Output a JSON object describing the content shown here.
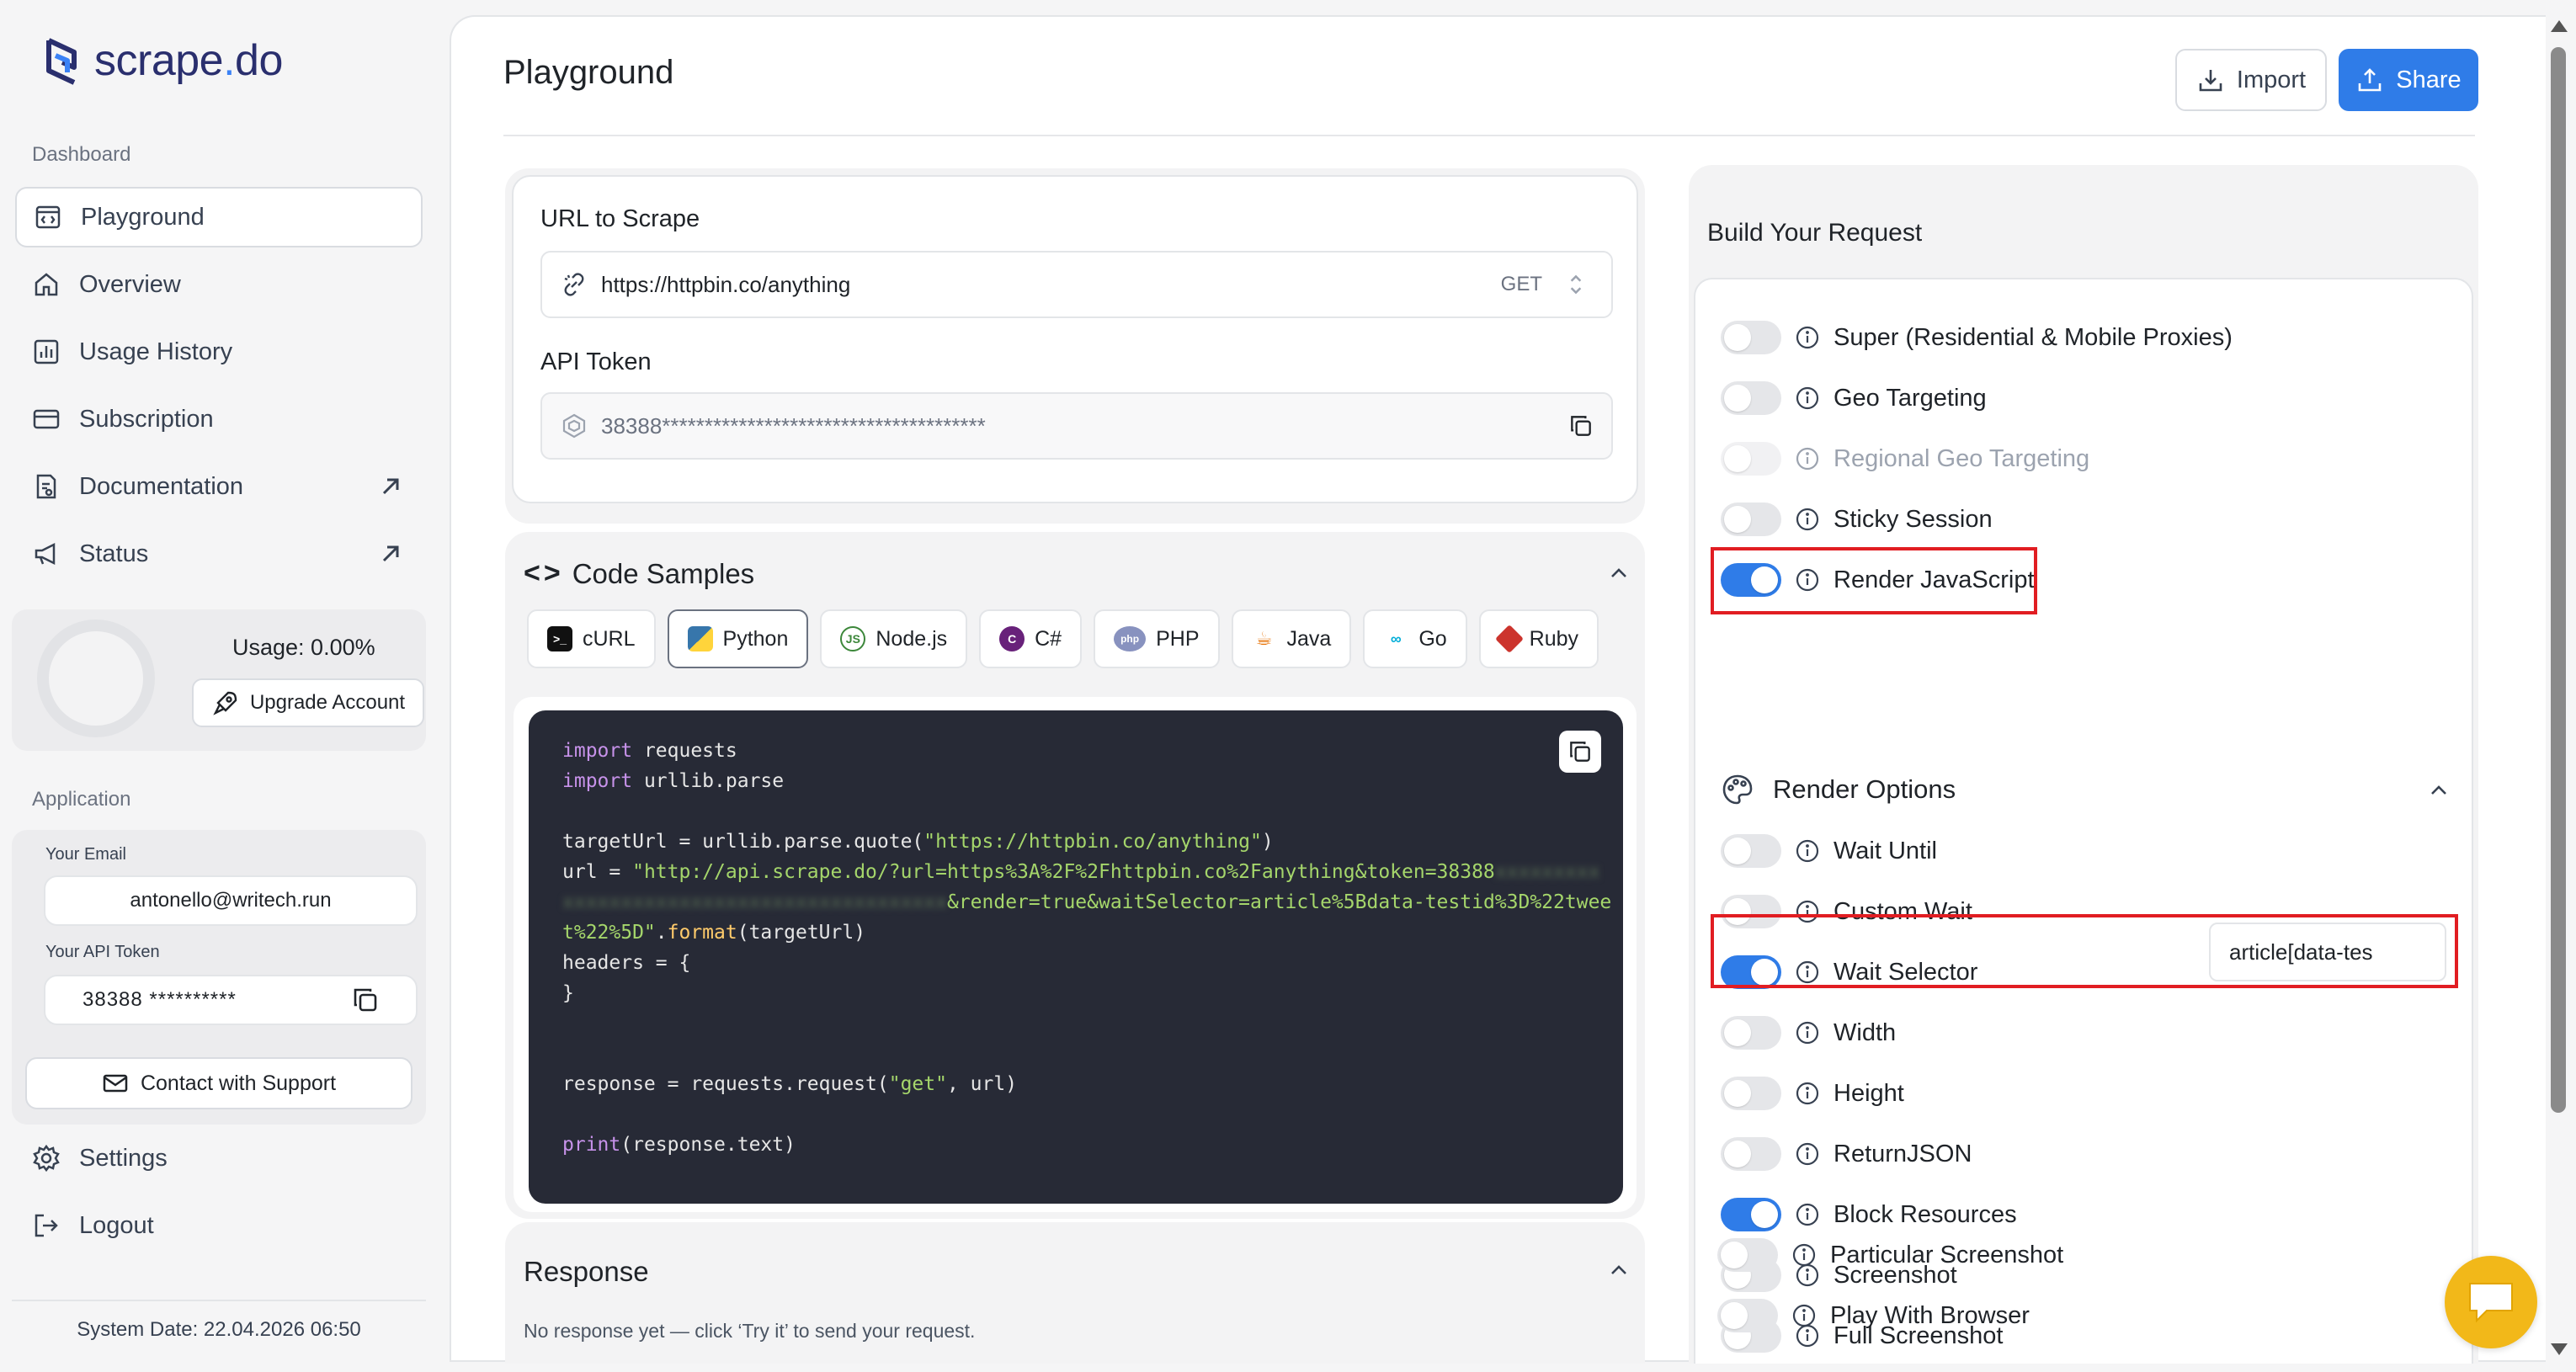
{
  "brand": {
    "name_main": "scrape",
    "name_dot": ".",
    "name_end": "do",
    "accent": "#3b82f6"
  },
  "sidebar": {
    "section_dashboard": "Dashboard",
    "items": [
      {
        "label": "Playground",
        "icon": "playground-icon",
        "active": true
      },
      {
        "label": "Overview",
        "icon": "home-icon"
      },
      {
        "label": "Usage History",
        "icon": "chart-icon"
      },
      {
        "label": "Subscription",
        "icon": "card-icon"
      },
      {
        "label": "Documentation",
        "icon": "document-icon",
        "external": true
      },
      {
        "label": "Status",
        "icon": "megaphone-icon",
        "external": true
      }
    ],
    "usage_label": "Usage: 0.00%",
    "upgrade_label": "Upgrade Account",
    "section_application": "Application",
    "email_label": "Your Email",
    "email_value": "antonello@writech.run",
    "token_label": "Your API Token",
    "token_value": "38388 **********",
    "support_label": "Contact with Support",
    "settings_label": "Settings",
    "logout_label": "Logout",
    "system_date": "System Date: 22.04.2026 06:50"
  },
  "header": {
    "title": "Playground",
    "import_label": "Import",
    "share_label": "Share",
    "share_color": "#2f7ce8"
  },
  "request": {
    "url_label": "URL to Scrape",
    "url_value": "https://httpbin.co/anything",
    "method": "GET",
    "token_label": "API Token",
    "token_value": "38388**************************************"
  },
  "code_samples": {
    "title": "Code Samples",
    "tabs": [
      {
        "label": "cURL",
        "icon": "terminal-icon"
      },
      {
        "label": "Python",
        "icon": "python-icon",
        "active": true
      },
      {
        "label": "Node.js",
        "icon": "nodejs-icon"
      },
      {
        "label": "C#",
        "icon": "csharp-icon"
      },
      {
        "label": "PHP",
        "icon": "php-icon"
      },
      {
        "label": "Java",
        "icon": "java-icon"
      },
      {
        "label": "Go",
        "icon": "go-icon"
      },
      {
        "label": "Ruby",
        "icon": "ruby-icon"
      }
    ],
    "code": {
      "l1_kw": "import",
      "l1_rest": " requests",
      "l2_kw": "import",
      "l2_rest": " urllib.parse",
      "l4_a": "targetUrl = urllib.parse.quote(",
      "l4_str": "\"https://httpbin.co/anything\"",
      "l4_b": ")",
      "l5_a": "url = ",
      "l5_str": "\"http://api.scrape.do/?url=https%3A%2F%2Fhttpbin.co%2Fanything&token=38388",
      "l5_blur": "xxxxxxxxx",
      "l6_blur": "xxxxxxxxxxxxxxxxxxxxxxxxxxxxxxxxx",
      "l6_str": "&render=true&waitSelector=article%5Bdata-testid%3D%22twee",
      "l7_str": "t%22%5D\"",
      "l7_dot": ".",
      "l7_fn": "format",
      "l7_rest": "(targetUrl)",
      "l8": "headers = {",
      "l9": "}",
      "l12_a": "response = requests.request(",
      "l12_str": "\"get\"",
      "l12_b": ", url)",
      "l14_fn": "print",
      "l14_rest": "(response.text)"
    }
  },
  "response": {
    "title": "Response",
    "empty_text": "No response yet — click ‘Try it’ to send your request."
  },
  "build": {
    "title": "Build Your Request",
    "options": [
      {
        "label": "Super (Residential & Mobile Proxies)",
        "on": false
      },
      {
        "label": "Geo Targeting",
        "on": false
      },
      {
        "label": "Regional Geo Targeting",
        "on": false,
        "disabled": true
      },
      {
        "label": "Sticky Session",
        "on": false
      },
      {
        "label": "Render JavaScript",
        "on": true
      }
    ],
    "render_options_title": "Render Options",
    "render_options": [
      {
        "label": "Wait Until",
        "on": false
      },
      {
        "label": "Custom Wait",
        "on": false
      },
      {
        "label": "Wait Selector",
        "on": true
      },
      {
        "label": "Width",
        "on": false
      },
      {
        "label": "Height",
        "on": false
      },
      {
        "label": "ReturnJSON",
        "on": false
      },
      {
        "label": "Block Resources",
        "on": true
      },
      {
        "label": "Screenshot",
        "on": false
      },
      {
        "label": "Full Screenshot",
        "on": false
      },
      {
        "label": "Particular Screenshot",
        "on": false
      },
      {
        "label": "Play With Browser",
        "on": false
      }
    ],
    "wait_selector_value": "article[data-tes",
    "highlight_color": "#e11d22"
  }
}
